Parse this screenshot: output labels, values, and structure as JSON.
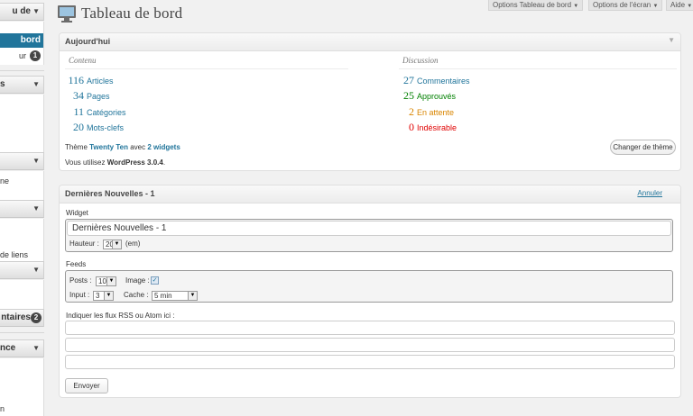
{
  "sidebar": {
    "head1": "u de",
    "active": "bord",
    "item1": "ur",
    "item1_badge": "1",
    "head2": "s",
    "item_theme": "ne",
    "item_links": "de liens",
    "head_comments": "ntaires",
    "comments_badge": "2",
    "head_appearance": "nce",
    "item_last": "n"
  },
  "topbar": {
    "title": "Tableau de bord",
    "options_btn": "Options Tableau de bord",
    "screen_btn": "Options de l'écran",
    "help_btn": "Aide"
  },
  "today": {
    "title": "Aujourd'hui",
    "content_heading": "Contenu",
    "discussion_heading": "Discussion",
    "content": [
      {
        "num": "116",
        "label": "Articles"
      },
      {
        "num": "34",
        "label": "Pages"
      },
      {
        "num": "11",
        "label": "Catégories"
      },
      {
        "num": "20",
        "label": "Mots-clefs"
      }
    ],
    "discussion": [
      {
        "num": "27",
        "label": "Commentaires"
      },
      {
        "num": "25",
        "label": "Approuvés"
      },
      {
        "num": "2",
        "label": "En attente"
      },
      {
        "num": "0",
        "label": "Indésirable"
      }
    ],
    "theme_prefix": "Thème",
    "theme_name": "Twenty Ten",
    "theme_mid": "avec",
    "widgets_link": "2 widgets",
    "version_prefix": "Vous utilisez",
    "version": "WordPress 3.0.4",
    "version_suffix": ".",
    "change_theme": "Changer de thème"
  },
  "news": {
    "title": "Dernières Nouvelles - 1",
    "cancel": "Annuler",
    "widget_label": "Widget",
    "widget_title_value": "Dernières Nouvelles - 1",
    "height_label": "Hauteur :",
    "height_value": "20",
    "height_unit": "(em)",
    "feeds_label": "Feeds",
    "posts_label": "Posts :",
    "posts_value": "10",
    "image_label": "Image :",
    "image_checked": "✓",
    "input_label": "Input :",
    "input_value": "3",
    "cache_label": "Cache :",
    "cache_value": "5 min",
    "rss_label": "Indiquer les flux RSS ou Atom ici :",
    "rss_values": [
      "",
      "",
      ""
    ],
    "submit": "Envoyer"
  },
  "colors": {
    "accent": "#21759b",
    "approved": "#008000",
    "pending": "#d98500",
    "spam": "#e00000"
  }
}
